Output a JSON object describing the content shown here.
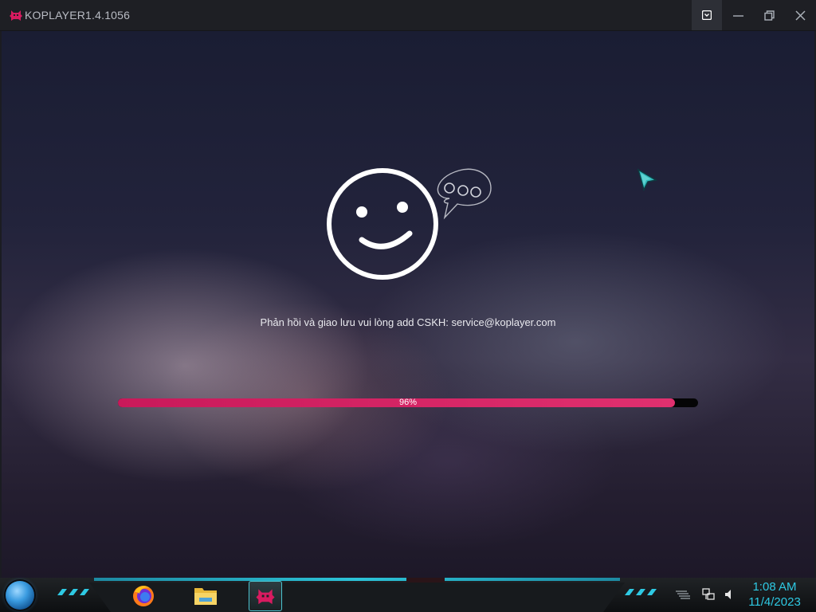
{
  "window": {
    "title": "KOPLAYER1.4.1056",
    "controls": [
      "collapse-icon",
      "minimize-icon",
      "restore-icon",
      "close-icon"
    ]
  },
  "loading": {
    "feedback_text": "Phản hồi và giao lưu vui lòng add CSKH: service@koplayer.com",
    "progress_value": 0.96,
    "progress_label": "96%",
    "icons": [
      "smiley-face-icon",
      "speech-bubble-icon",
      "cursor-arrow-icon"
    ]
  },
  "taskbar": {
    "apps": [
      {
        "name": "firefox",
        "icon": "firefox-icon"
      },
      {
        "name": "file-explorer",
        "icon": "folder-icon"
      },
      {
        "name": "koplayer",
        "icon": "koplayer-icon",
        "active": true
      }
    ],
    "tray_icons": [
      "show-desktop-icon",
      "network-icon",
      "volume-icon"
    ],
    "clock_time": "1:08 AM",
    "clock_date": "11/4/2023"
  },
  "colors": {
    "accent": "#d81b60",
    "taskbar_cyan": "#2ec9e3",
    "titlebar": "#1e1f24"
  }
}
